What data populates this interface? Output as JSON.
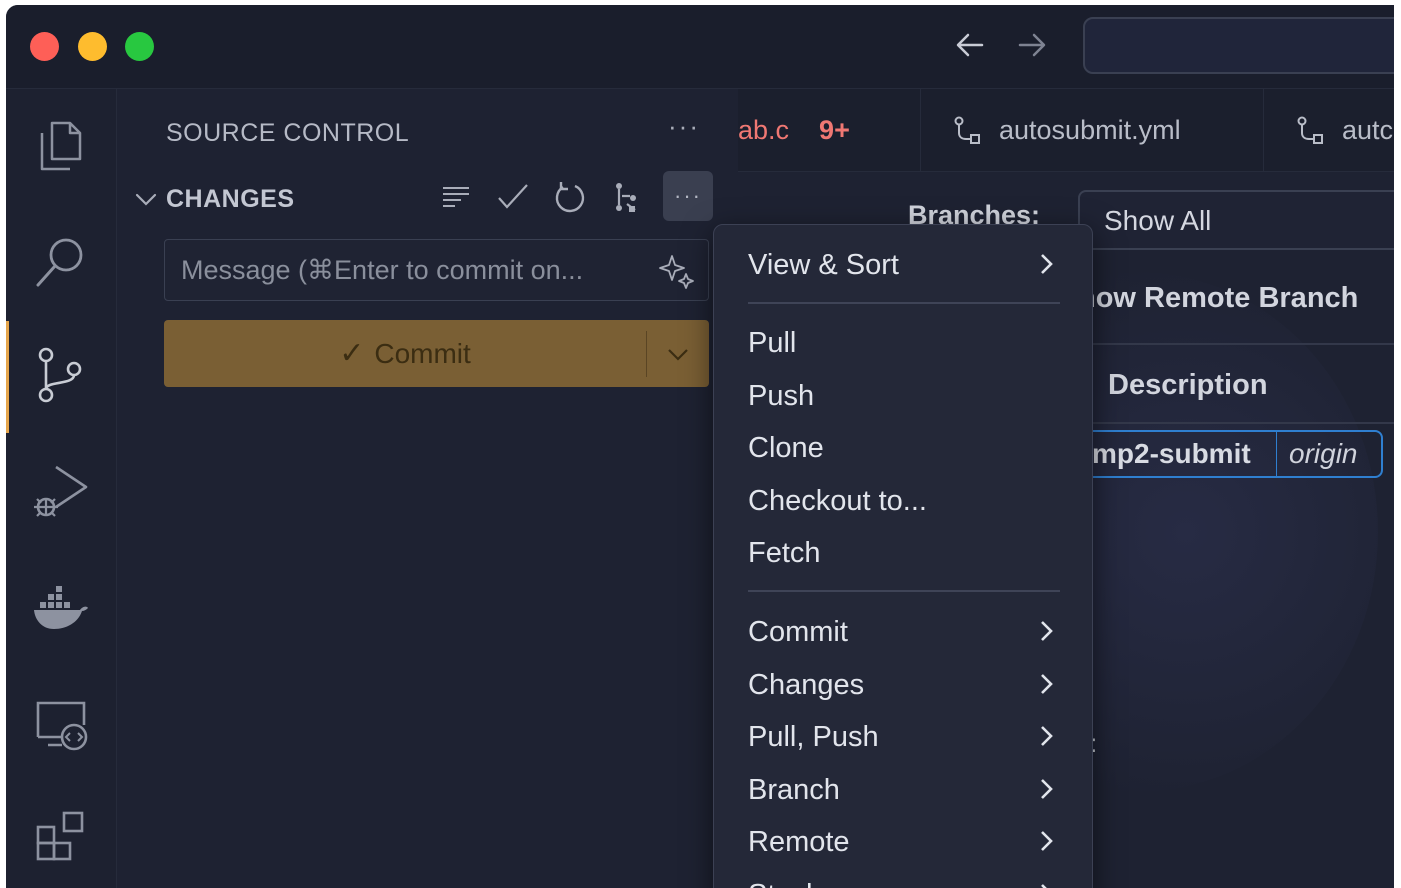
{
  "window": {
    "traffic_lights": {
      "close": "#fe5f57",
      "minimize": "#febc2e",
      "zoom": "#28c840"
    },
    "nav_back_icon": "arrow-left-icon",
    "nav_forward_icon": "arrow-right-icon"
  },
  "activity_bar": {
    "items": [
      {
        "name": "explorer",
        "icon": "files-icon"
      },
      {
        "name": "search",
        "icon": "search-icon"
      },
      {
        "name": "source-control",
        "icon": "source-control-icon",
        "active": true
      },
      {
        "name": "run-and-debug",
        "icon": "debug-icon"
      },
      {
        "name": "docker",
        "icon": "docker-icon"
      },
      {
        "name": "remote-explorer",
        "icon": "remote-explorer-icon"
      },
      {
        "name": "extensions",
        "icon": "extensions-icon"
      }
    ],
    "active_color": "#e5a54b"
  },
  "sidebar": {
    "title": "SOURCE CONTROL",
    "more_label": "···",
    "changes_section": {
      "label": "CHANGES",
      "more_label": "···",
      "toolbar_icons": [
        "list-view-icon",
        "check-icon",
        "refresh-icon",
        "graph-icon",
        "more-icon"
      ]
    },
    "message_placeholder": "Message (⌘Enter to commit on...",
    "message_value": "",
    "commit_button": {
      "label": "Commit",
      "check": "✓",
      "color": "#7a5f34"
    }
  },
  "tabs": {
    "active": {
      "filename": "ab.c",
      "badge": "9+"
    },
    "items": [
      {
        "label": "autosubmit.yml",
        "icon": "git-pull-request-icon"
      },
      {
        "label": "autc",
        "icon": "git-pull-request-icon"
      }
    ]
  },
  "editor": {
    "branches_label": "Branches:",
    "branches_select": "Show All",
    "remote_branches": "how Remote Branch",
    "description_header": "Description",
    "ref": {
      "name": "mp2-submit",
      "remote": "origin"
    },
    "colon": ":"
  },
  "context_menu": {
    "items": [
      {
        "label": "View & Sort",
        "submenu": true
      },
      {
        "separator": true
      },
      {
        "label": "Pull",
        "submenu": false
      },
      {
        "label": "Push",
        "submenu": false
      },
      {
        "label": "Clone",
        "submenu": false
      },
      {
        "label": "Checkout to...",
        "submenu": false
      },
      {
        "label": "Fetch",
        "submenu": false
      },
      {
        "separator": true
      },
      {
        "label": "Commit",
        "submenu": true
      },
      {
        "label": "Changes",
        "submenu": true
      },
      {
        "label": "Pull, Push",
        "submenu": true
      },
      {
        "label": "Branch",
        "submenu": true
      },
      {
        "label": "Remote",
        "submenu": true
      },
      {
        "label": "Stash",
        "submenu": true
      }
    ]
  }
}
